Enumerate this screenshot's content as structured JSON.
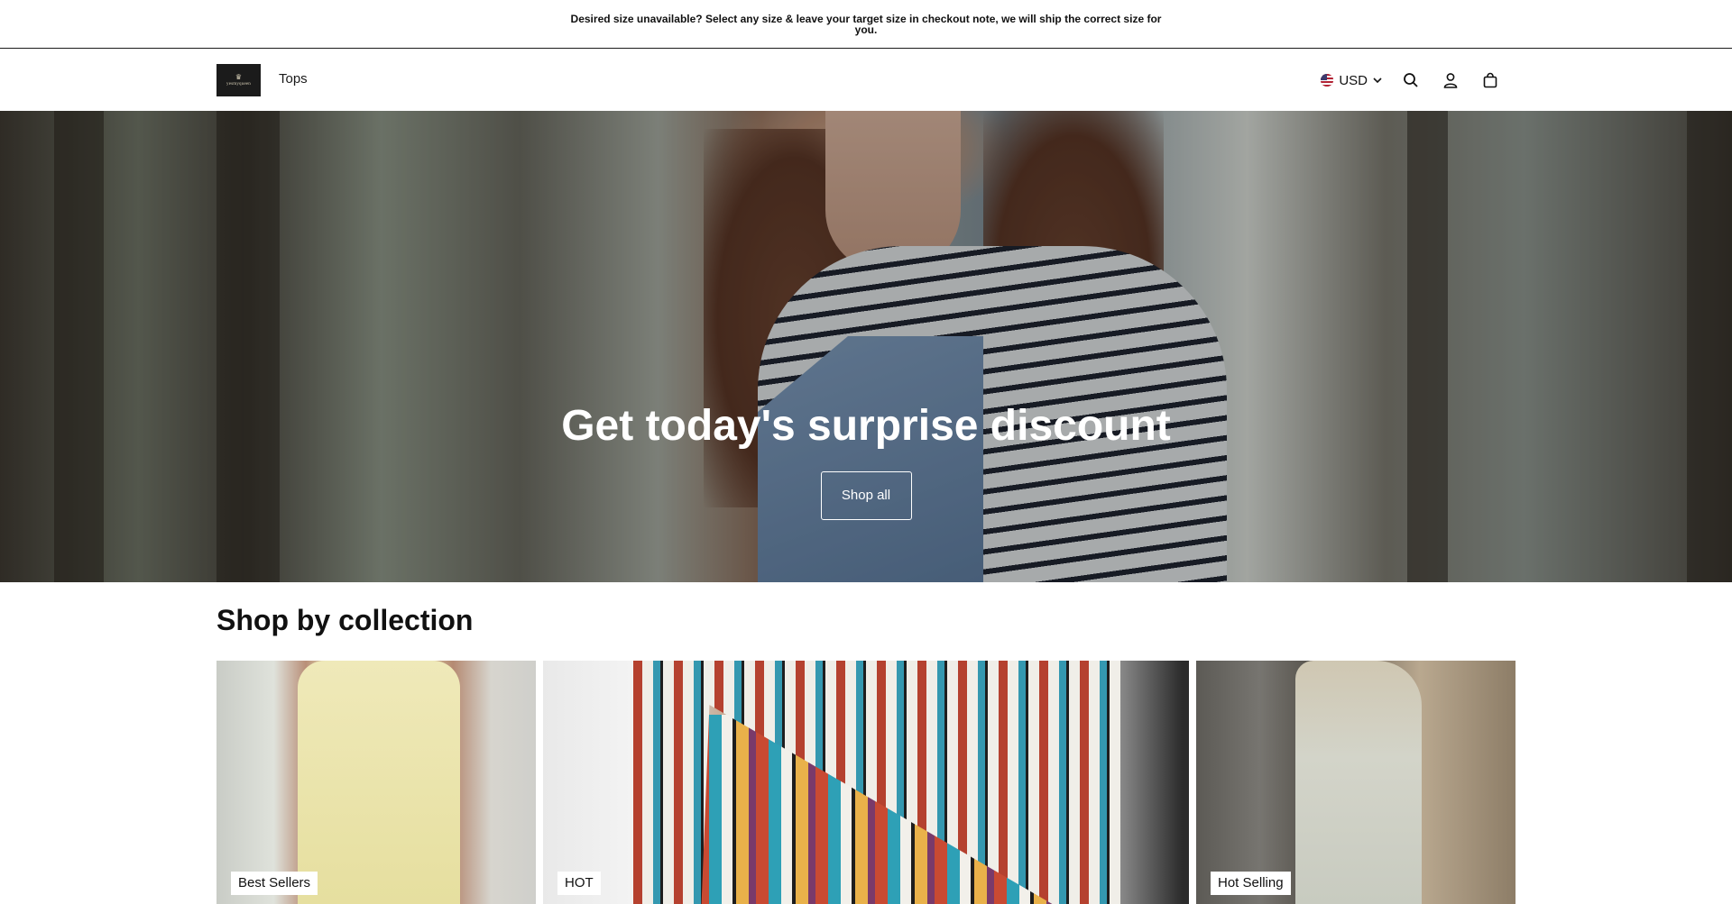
{
  "announcement": {
    "text": "Desired size unavailable? Select any size & leave your target size in checkout note, we will ship the correct size for you."
  },
  "header": {
    "logo_icon": "crown-logo",
    "logo_text": "yesmyqueen",
    "nav_items": [
      {
        "label": "Tops"
      }
    ],
    "currency": {
      "flag_icon": "us-flag-icon",
      "label": "USD",
      "caret_icon": "chevron-down-icon"
    },
    "icons": [
      "search-icon",
      "account-icon",
      "cart-icon"
    ]
  },
  "hero": {
    "title": "Get today's surprise discount",
    "button_label": "Shop all"
  },
  "collections": {
    "title": "Shop by collection",
    "items": [
      {
        "label": "Best Sellers"
      },
      {
        "label": "HOT"
      },
      {
        "label": "Hot Selling"
      }
    ]
  }
}
